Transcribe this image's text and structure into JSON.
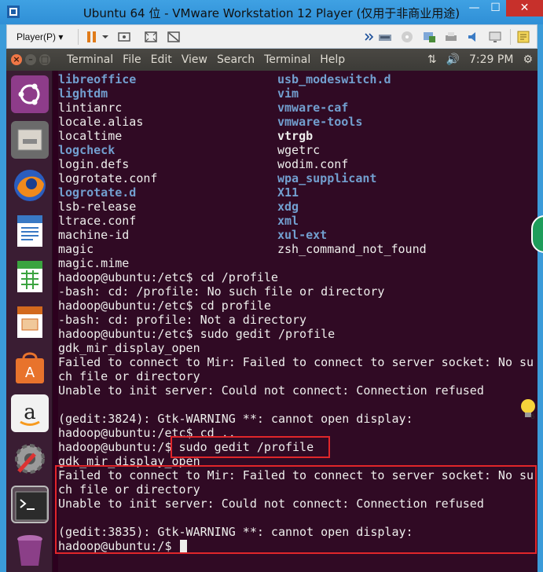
{
  "window": {
    "title": "Ubuntu 64 位 - VMware Workstation 12 Player (仅用于非商业用途)",
    "min_glyph": "—",
    "max_glyph": "☐",
    "close_glyph": "✕"
  },
  "vmware_toolbar": {
    "player_menu": "Player(P) ▾",
    "icons": [
      "pause-icon",
      "send-ctrl-alt-del-icon",
      "fullscreen-icon",
      "unity-icon",
      "devices-overflow-icon",
      "network-adapter-icon",
      "cd-drive-icon",
      "usb-icon",
      "printer-icon",
      "sound-card-icon",
      "display-icon",
      "message-log-icon"
    ]
  },
  "ubuntu_panel": {
    "menus": [
      "Terminal",
      "File",
      "Edit",
      "View",
      "Search",
      "Terminal",
      "Help"
    ],
    "network_glyph": "⇅",
    "volume_glyph": "🔊",
    "clock": "7:29 PM",
    "settings_glyph": "⚙"
  },
  "launcher": {
    "apps": [
      "ubuntu-dash",
      "files",
      "firefox",
      "libreoffice-writer",
      "libreoffice-calc",
      "libreoffice-impress",
      "ubuntu-software-center",
      "amazon",
      "system-settings",
      "terminal",
      "trash"
    ]
  },
  "terminal": {
    "listing_left": [
      "libreoffice",
      "lightdm",
      "lintianrc",
      "locale.alias",
      "localtime",
      "logcheck",
      "login.defs",
      "logrotate.conf",
      "logrotate.d",
      "lsb-release",
      "ltrace.conf",
      "machine-id",
      "magic",
      "magic.mime"
    ],
    "listing_right": [
      "usb_modeswitch.d",
      "vim",
      "vmware-caf",
      "vmware-tools",
      "vtrgb",
      "wgetrc",
      "wodim.conf",
      "wpa_supplicant",
      "X11",
      "xdg",
      "xml",
      "xul-ext",
      "zsh_command_not_found",
      ""
    ],
    "output_lines": [
      "hadoop@ubuntu:/etc$ cd /profile",
      "-bash: cd: /profile: No such file or directory",
      "hadoop@ubuntu:/etc$ cd profile",
      "-bash: cd: profile: Not a directory",
      "hadoop@ubuntu:/etc$ sudo gedit /profile",
      "gdk_mir_display_open",
      "Failed to connect to Mir: Failed to connect to server socket: No su",
      "ch file or directory",
      "Unable to init server: Could not connect: Connection refused",
      "",
      "(gedit:3824): Gtk-WARNING **: cannot open display:",
      "hadoop@ubuntu:/etc$ cd ..",
      "hadoop@ubuntu:/$ sudo gedit /profile",
      "gdk_mir_display_open",
      "Failed to connect to Mir: Failed to connect to server socket: No su",
      "ch file or directory",
      "Unable to init server: Could not connect: Connection refused",
      "",
      "(gedit:3835): Gtk-WARNING **: cannot open display:",
      "hadoop@ubuntu:/$ "
    ]
  }
}
